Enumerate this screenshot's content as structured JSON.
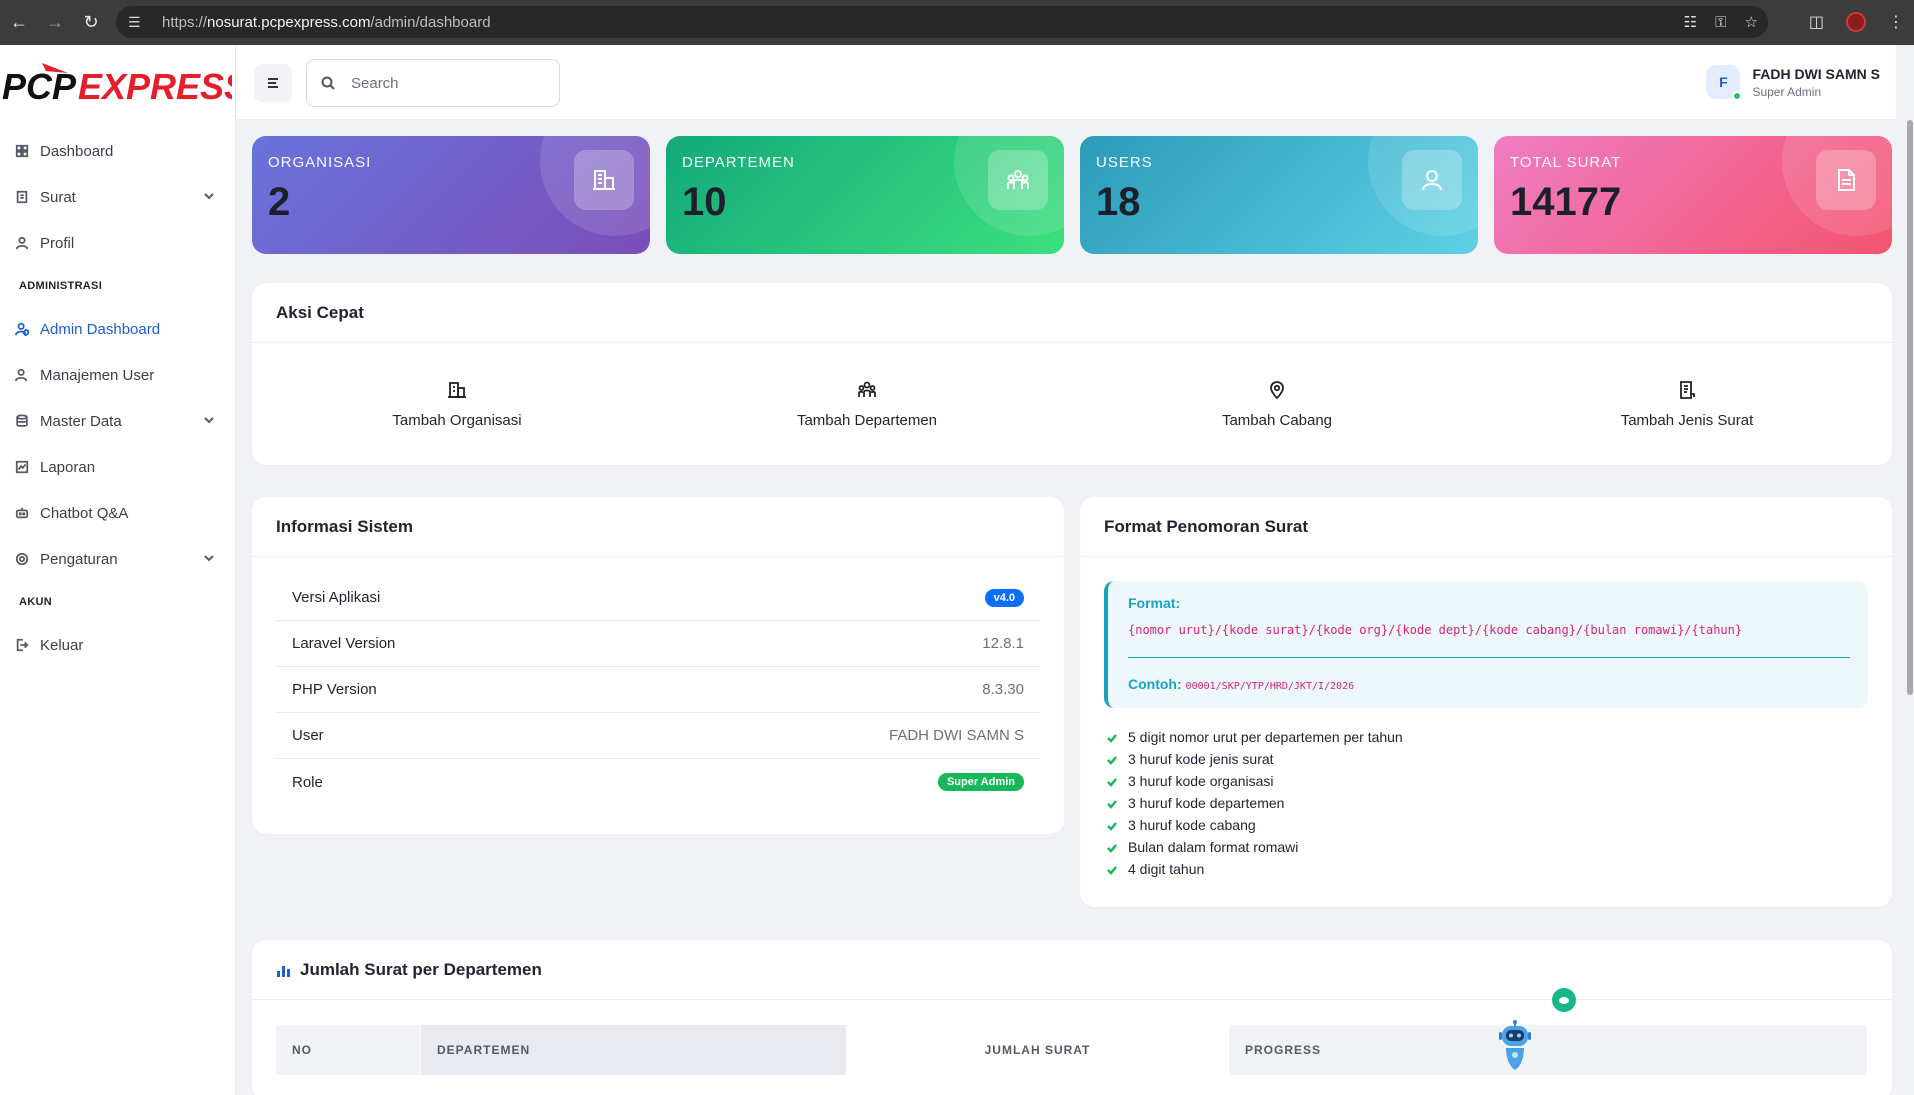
{
  "browser": {
    "url_prefix": "https://",
    "url_host": "nosurat.pcpexpress.com",
    "url_path": "/admin/dashboard"
  },
  "brand": {
    "logo_text": "PCPEXPRESS",
    "accent": "#e3202a"
  },
  "sidebar": {
    "items": [
      {
        "label": "Dashboard",
        "icon": "dashboard-icon"
      },
      {
        "label": "Surat",
        "icon": "document-icon",
        "has_submenu": true
      },
      {
        "label": "Profil",
        "icon": "user-icon"
      }
    ],
    "section_admin": "ADMINISTRASI",
    "admin_items": [
      {
        "label": "Admin Dashboard",
        "icon": "user-shield-icon",
        "active": true
      },
      {
        "label": "Manajemen User",
        "icon": "users-icon"
      },
      {
        "label": "Master Data",
        "icon": "database-icon",
        "has_submenu": true
      },
      {
        "label": "Laporan",
        "icon": "report-icon"
      },
      {
        "label": "Chatbot Q&A",
        "icon": "robot-icon"
      },
      {
        "label": "Pengaturan",
        "icon": "gear-icon",
        "has_submenu": true
      }
    ],
    "section_account": "AKUN",
    "account_items": [
      {
        "label": "Keluar",
        "icon": "logout-icon"
      }
    ]
  },
  "topbar": {
    "search_placeholder": "Search",
    "user_initial": "F",
    "user_name": "FADH DWI SAMN S",
    "user_role": "Super Admin"
  },
  "stats": [
    {
      "label": "ORGANISASI",
      "value": "2",
      "icon": "building-icon"
    },
    {
      "label": "DEPARTEMEN",
      "value": "10",
      "icon": "team-icon"
    },
    {
      "label": "USERS",
      "value": "18",
      "icon": "user-icon"
    },
    {
      "label": "TOTAL SURAT",
      "value": "14177",
      "icon": "file-icon"
    }
  ],
  "quick_actions": {
    "title": "Aksi Cepat",
    "items": [
      {
        "label": "Tambah Organisasi",
        "icon": "building-icon"
      },
      {
        "label": "Tambah Departemen",
        "icon": "team-icon"
      },
      {
        "label": "Tambah Cabang",
        "icon": "map-pin-icon"
      },
      {
        "label": "Tambah Jenis Surat",
        "icon": "file-list-icon"
      }
    ]
  },
  "system_info": {
    "title": "Informasi Sistem",
    "rows": [
      {
        "label": "Versi Aplikasi",
        "value": "v4.0",
        "badge": "blue"
      },
      {
        "label": "Laravel Version",
        "value": "12.8.1"
      },
      {
        "label": "PHP Version",
        "value": "8.3.30"
      },
      {
        "label": "User",
        "value": "FADH DWI SAMN S"
      },
      {
        "label": "Role",
        "value": "Super Admin",
        "badge": "green"
      }
    ]
  },
  "numbering_format": {
    "title": "Format Penomoran Surat",
    "format_label": "Format:",
    "format_code": "{nomor urut}/{kode surat}/{kode org}/{kode dept}/{kode cabang}/{bulan romawi}/{tahun}",
    "example_label": "Contoh:",
    "example_code": "00001/SKP/YTP/HRD/JKT/I/2026",
    "rules": [
      "5 digit nomor urut per departemen per tahun",
      "3 huruf kode jenis surat",
      "3 huruf kode organisasi",
      "3 huruf kode departemen",
      "3 huruf kode cabang",
      "Bulan dalam format romawi",
      "4 digit tahun"
    ]
  },
  "dept_table": {
    "title": "Jumlah Surat per Departemen",
    "columns": [
      "NO",
      "DEPARTEMEN",
      "JUMLAH SURAT",
      "PROGRESS"
    ]
  }
}
